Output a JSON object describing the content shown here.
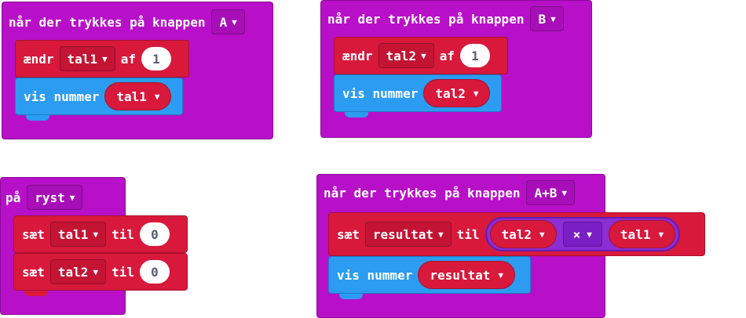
{
  "blocks": {
    "btnA": {
      "label": "når der trykkes på knappen",
      "button": "A",
      "change_kw": "ændr",
      "change_var": "tal1",
      "change_by": "af",
      "change_val": "1",
      "show_kw": "vis nummer",
      "show_var": "tal1"
    },
    "btnB": {
      "label": "når der trykkes på knappen",
      "button": "B",
      "change_kw": "ændr",
      "change_var": "tal2",
      "change_by": "af",
      "change_val": "1",
      "show_kw": "vis nummer",
      "show_var": "tal2"
    },
    "shake": {
      "label": "på",
      "gesture": "ryst",
      "set1_kw": "sæt",
      "set1_var": "tal1",
      "set1_to": "til",
      "set1_val": "0",
      "set2_kw": "sæt",
      "set2_var": "tal2",
      "set2_to": "til",
      "set2_val": "0"
    },
    "btnAB": {
      "label": "når der trykkes på knappen",
      "button": "A+B",
      "set_kw": "sæt",
      "set_var": "resultat",
      "set_to": "til",
      "left": "tal2",
      "op": "×",
      "right": "tal1",
      "show_kw": "vis nummer",
      "show_var": "resultat"
    }
  },
  "colors": {
    "event": "#b810c8",
    "variables": "#d8193c",
    "basic": "#2c9cf2",
    "math": "#8c2dd6"
  },
  "icons": {
    "dropdown": "caret-down-icon"
  }
}
